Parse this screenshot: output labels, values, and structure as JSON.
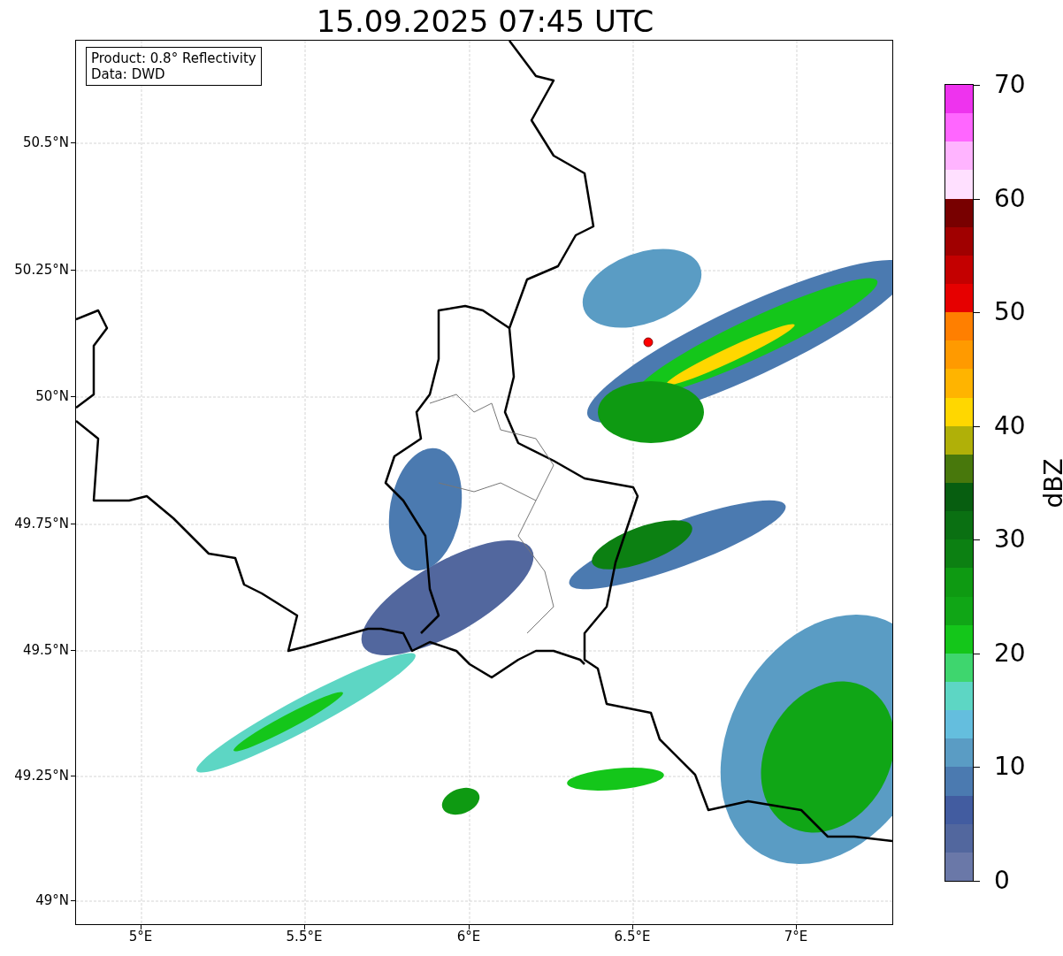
{
  "title": "15.09.2025 07:45 UTC",
  "info_box": [
    "Product: 0.8° Reflectivity",
    "Data: DWD"
  ],
  "map": {
    "x_ticks": [
      "5°E",
      "5.5°E",
      "6°E",
      "6.5°E",
      "7°E"
    ],
    "y_ticks": [
      "50.5°N",
      "50.25°N",
      "50°N",
      "49.75°N",
      "49.5°N",
      "49.25°N",
      "49°N"
    ]
  },
  "colorbar": {
    "label": "dBZ",
    "ticks": [
      "70",
      "60",
      "50",
      "40",
      "30",
      "20",
      "10",
      "0"
    ],
    "segments": [
      {
        "color": "#6a78a8"
      },
      {
        "color": "#52679e"
      },
      {
        "color": "#425ca0"
      },
      {
        "color": "#4b7ab0"
      },
      {
        "color": "#5a9cc4"
      },
      {
        "color": "#64bede"
      },
      {
        "color": "#5dd6c4"
      },
      {
        "color": "#3ed66e"
      },
      {
        "color": "#14c61a"
      },
      {
        "color": "#10a616"
      },
      {
        "color": "#0e9a12"
      },
      {
        "color": "#0c8012"
      },
      {
        "color": "#0a7012"
      },
      {
        "color": "#075e10"
      },
      {
        "color": "#48780c"
      },
      {
        "color": "#b0b008"
      },
      {
        "color": "#ffd700"
      },
      {
        "color": "#ffb400"
      },
      {
        "color": "#ff9a00"
      },
      {
        "color": "#ff7f00"
      },
      {
        "color": "#e60000"
      },
      {
        "color": "#c40000"
      },
      {
        "color": "#a00000"
      },
      {
        "color": "#780000"
      },
      {
        "color": "#ffe0ff"
      },
      {
        "color": "#ffb4ff"
      },
      {
        "color": "#ff66ff"
      },
      {
        "color": "#ee33ee"
      }
    ]
  }
}
